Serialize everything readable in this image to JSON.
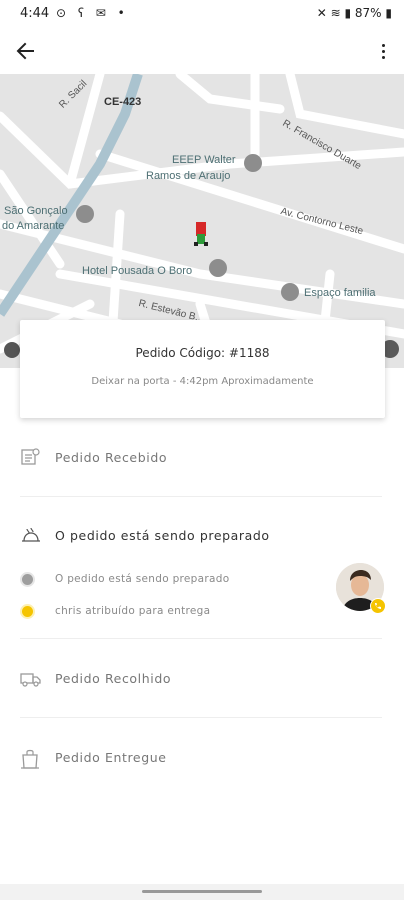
{
  "status_bar": {
    "time": "4:44",
    "battery": "87%"
  },
  "icons": {
    "back": "back-arrow-icon",
    "more": "more-vert-icon"
  },
  "map": {
    "labels": {
      "street_sacil": "R. Sacil",
      "ce423": "CE-423",
      "francisco_duarte": "R. Francisco Duarte",
      "eeep_line1": "EEEP Walter",
      "eeep_line2": "Ramos de Araujo",
      "contorno_leste": "Av. Contorno Leste",
      "sao_goncalo_line1": "São Gonçalo",
      "sao_goncalo_line2": "do Amarante",
      "hotel": "Hotel Pousada O Boro",
      "espaco_familia": "Espaço familia",
      "estevao": "R. Estevão B..."
    }
  },
  "order": {
    "title": "Pedido Código: #1188",
    "subtitle": "Deixar na porta - 4:42pm Aproximadamente"
  },
  "steps": {
    "received": "Pedido Recebido",
    "preparing": "O pedido está sendo preparado",
    "sub_preparing": "O pedido está sendo preparado",
    "sub_assigned": "chris atribuído para entrega",
    "collected": "Pedido Recolhido",
    "delivered": "Pedido Entregue"
  },
  "colors": {
    "map_bg": "#e4e4e4",
    "road": "#ffffff",
    "water": "#aac3cf",
    "accent_yellow": "#f5c400",
    "grey_dot": "#9e9e9e"
  }
}
